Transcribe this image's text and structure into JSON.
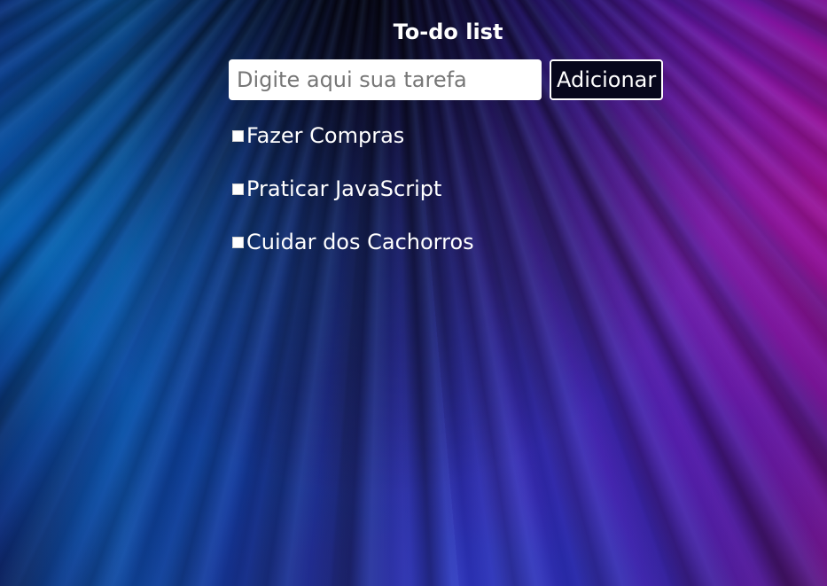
{
  "app": {
    "title": "To-do list"
  },
  "form": {
    "input_placeholder": "Digite aqui sua tarefa",
    "input_value": "",
    "add_button_label": "Adicionar"
  },
  "tasks": [
    {
      "label": "Fazer Compras",
      "checked": false
    },
    {
      "label": "Praticar JavaScript",
      "checked": false
    },
    {
      "label": "Cuidar dos Cachorros",
      "checked": false
    }
  ]
}
